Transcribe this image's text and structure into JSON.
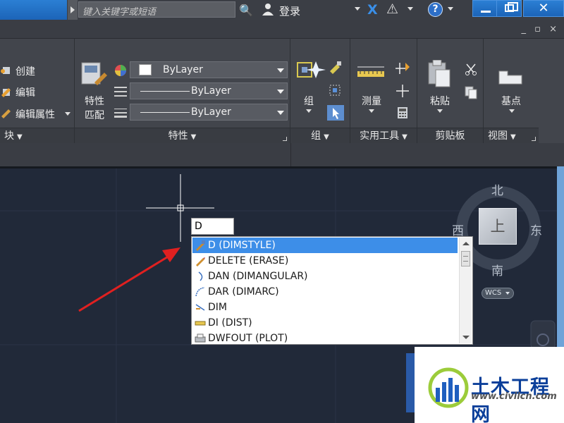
{
  "titlebar": {
    "search_placeholder": "键入关键字或短语",
    "login_label": "登录"
  },
  "ribbon": {
    "block_panel": {
      "create_label": "创建",
      "edit_label": "编辑",
      "edit_attr_label": "编辑属性",
      "title": "块"
    },
    "properties_panel": {
      "match_props_label_1": "特性",
      "match_props_label_2": "匹配",
      "color_value": "ByLayer",
      "linetype_value": "ByLayer",
      "lineweight_value": "ByLayer",
      "title": "特性"
    },
    "group_panel": {
      "group_label": "组",
      "title": "组"
    },
    "utilities_panel": {
      "measure_label": "测量",
      "title": "实用工具"
    },
    "clipboard_panel": {
      "paste_label": "粘贴",
      "title": "剪贴板"
    },
    "view_panel": {
      "base_label": "基点",
      "title": "视图"
    }
  },
  "command": {
    "input_value": "D",
    "suggestions": [
      {
        "label": "D (DIMSTYLE)",
        "icon": "dimstyle-icon",
        "selected": true
      },
      {
        "label": "DELETE (ERASE)",
        "icon": "erase-icon",
        "selected": false
      },
      {
        "label": "DAN (DIMANGULAR)",
        "icon": "dimangular-icon",
        "selected": false
      },
      {
        "label": "DAR (DIMARC)",
        "icon": "dimarc-icon",
        "selected": false
      },
      {
        "label": "DIM",
        "icon": "dim-icon",
        "selected": false
      },
      {
        "label": "DI (DIST)",
        "icon": "dist-icon",
        "selected": false
      },
      {
        "label": "DWFOUT (PLOT)",
        "icon": "plot-icon",
        "selected": false
      }
    ]
  },
  "viewcube": {
    "north": "北",
    "south": "南",
    "east": "东",
    "west": "西",
    "top_face": "上",
    "wcs_label": "WCS"
  },
  "watermark": {
    "title": "土木工程网",
    "url": "www.civilcn.com"
  },
  "colors": {
    "accent": "#3d8ee8",
    "drawing_bg": "#212939",
    "ribbon_bg": "#42454c",
    "arrow_red": "#e02020"
  }
}
